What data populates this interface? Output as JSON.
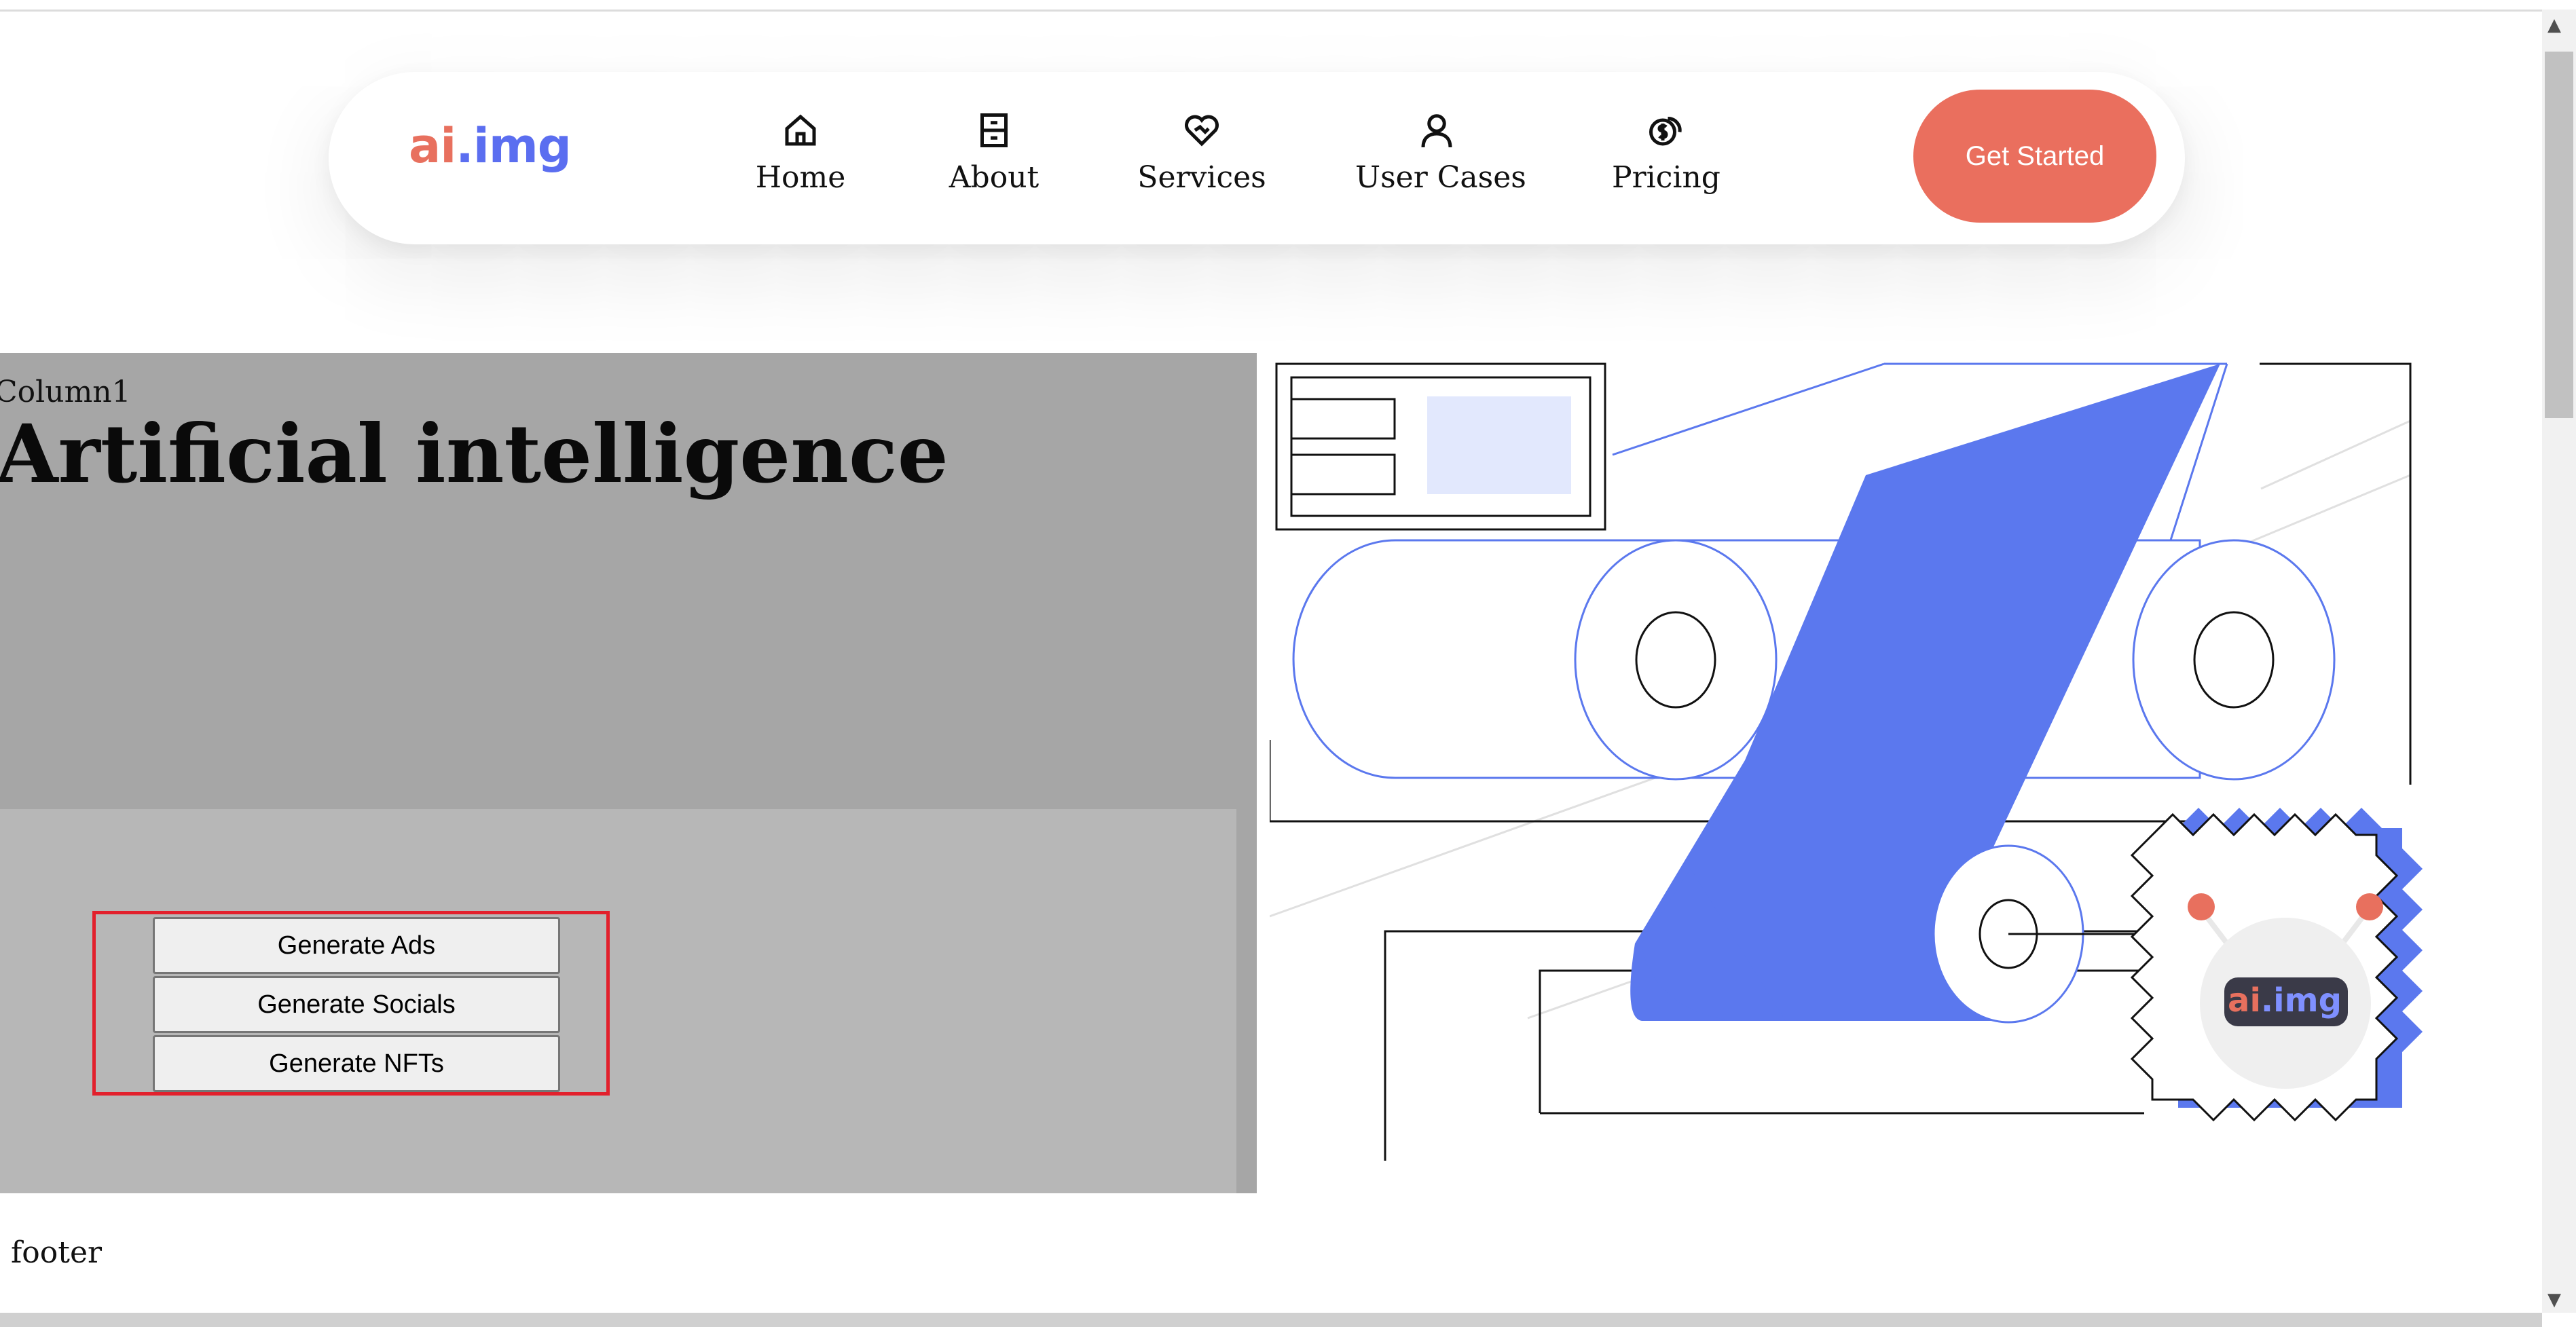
{
  "nav": {
    "logo_part1": "ai",
    "logo_part2": ".img",
    "items": [
      {
        "label": "Home",
        "icon": "home-icon"
      },
      {
        "label": "About",
        "icon": "archive-icon"
      },
      {
        "label": "Services",
        "icon": "handshake-heart-icon"
      },
      {
        "label": "User Cases",
        "icon": "user-icon"
      },
      {
        "label": "Pricing",
        "icon": "coins-icon"
      }
    ],
    "cta_label": "Get Started"
  },
  "hero": {
    "column_label": "Column1",
    "title": "Artificial intelligence",
    "buttons": [
      "Generate Ads",
      "Generate Socials",
      "Generate NFTs"
    ]
  },
  "illustration": {
    "badge_logo_part1": "ai",
    "badge_logo_part2": ".img"
  },
  "footer": {
    "text": "footer"
  },
  "colors": {
    "accent_coral": "#ea6f5e",
    "brand_blue": "#5b6ef0",
    "column_bg": "#a6a6a6",
    "panel_bg": "#b7b7b7",
    "highlight_border": "#e2202c"
  }
}
